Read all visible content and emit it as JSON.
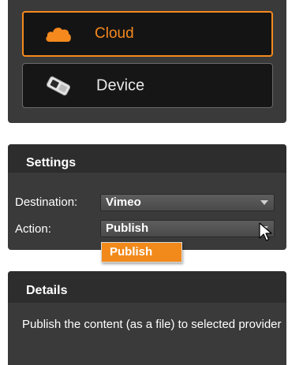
{
  "targets": {
    "cloud_label": "Cloud",
    "device_label": "Device"
  },
  "settings": {
    "header": "Settings",
    "destination_label": "Destination:",
    "destination_value": "Vimeo",
    "action_label": "Action:",
    "action_value": "Publish",
    "action_options": [
      "Publish"
    ]
  },
  "details": {
    "header": "Details",
    "text": "Publish the content (as a file) to selected provider"
  },
  "colors": {
    "accent": "#f5891e",
    "panel": "#3a3a3a",
    "header": "#2d2d2d",
    "button": "#141414"
  },
  "icons": {
    "cloud": "cloud-icon",
    "device": "device-icon",
    "dropdown": "chevron-down-icon",
    "cursor": "cursor-icon"
  }
}
